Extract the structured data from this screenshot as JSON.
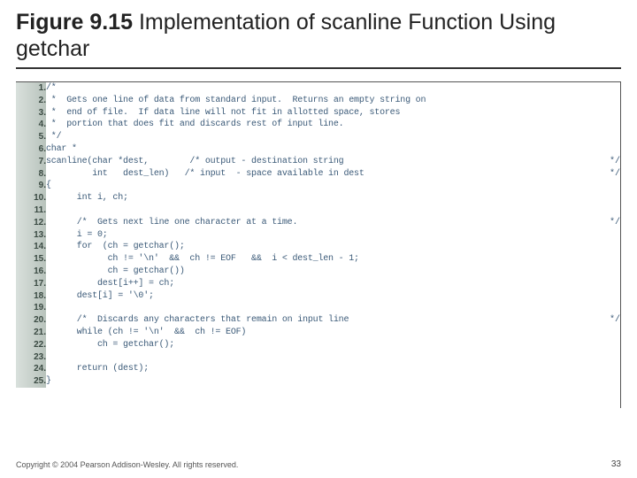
{
  "title": {
    "label": "Figure 9.15",
    "caption": "  Implementation of scanline Function Using getchar"
  },
  "footer": {
    "copyright": "Copyright © 2004 Pearson Addison-Wesley. All rights reserved.",
    "page": "33"
  },
  "code": {
    "lines": [
      {
        "n": "1.",
        "t": "/*",
        "r": ""
      },
      {
        "n": "2.",
        "t": " *  Gets one line of data from standard input.  Returns an empty string on",
        "r": ""
      },
      {
        "n": "3.",
        "t": " *  end of file.  If data line will not fit in allotted space, stores",
        "r": ""
      },
      {
        "n": "4.",
        "t": " *  portion that does fit and discards rest of input line.",
        "r": ""
      },
      {
        "n": "5.",
        "t": " */",
        "r": ""
      },
      {
        "n": "6.",
        "t": "char *",
        "r": ""
      },
      {
        "n": "7.",
        "t": "scanline(char *dest,        /* output - destination string",
        "r": "*/"
      },
      {
        "n": "8.",
        "t": "         int   dest_len)   /* input  - space available in dest",
        "r": "*/"
      },
      {
        "n": "9.",
        "t": "{",
        "r": ""
      },
      {
        "n": "10.",
        "t": "      int i, ch;",
        "r": ""
      },
      {
        "n": "11.",
        "t": "",
        "r": ""
      },
      {
        "n": "12.",
        "t": "      /*  Gets next line one character at a time.",
        "r": "*/"
      },
      {
        "n": "13.",
        "t": "      i = 0;",
        "r": ""
      },
      {
        "n": "14.",
        "t": "      for  (ch = getchar();",
        "r": ""
      },
      {
        "n": "15.",
        "t": "            ch != '\\n'  &&  ch != EOF   &&  i < dest_len - 1;",
        "r": ""
      },
      {
        "n": "16.",
        "t": "            ch = getchar())",
        "r": ""
      },
      {
        "n": "17.",
        "t": "          dest[i++] = ch;",
        "r": ""
      },
      {
        "n": "18.",
        "t": "      dest[i] = '\\0';",
        "r": ""
      },
      {
        "n": "19.",
        "t": "",
        "r": ""
      },
      {
        "n": "20.",
        "t": "      /*  Discards any characters that remain on input line",
        "r": "*/"
      },
      {
        "n": "21.",
        "t": "      while (ch != '\\n'  &&  ch != EOF)",
        "r": ""
      },
      {
        "n": "22.",
        "t": "          ch = getchar();",
        "r": ""
      },
      {
        "n": "23.",
        "t": "",
        "r": ""
      },
      {
        "n": "24.",
        "t": "      return (dest);",
        "r": ""
      },
      {
        "n": "25.",
        "t": "}",
        "r": ""
      }
    ]
  }
}
